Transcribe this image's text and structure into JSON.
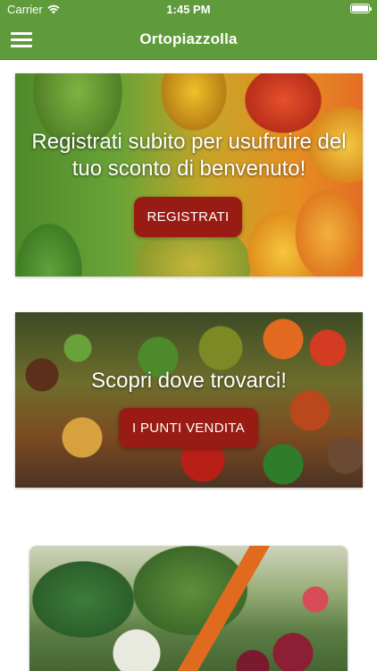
{
  "status_bar": {
    "carrier": "Carrier",
    "time": "1:45 PM"
  },
  "nav": {
    "title": "Ortopiazzolla",
    "menu_icon": "hamburger-icon"
  },
  "cards": [
    {
      "headline": "Registrati subito per usufruire del tuo sconto di benvenuto!",
      "button_label": "REGISTRATI",
      "image": "exotic-fruits-image"
    },
    {
      "headline": "Scopri dove trovarci!",
      "button_label": "I PUNTI VENDITA",
      "image": "market-stall-image"
    },
    {
      "image": "vegetables-image"
    }
  ],
  "colors": {
    "nav_green": "#5f9a3b",
    "button_red": "#991c14"
  }
}
